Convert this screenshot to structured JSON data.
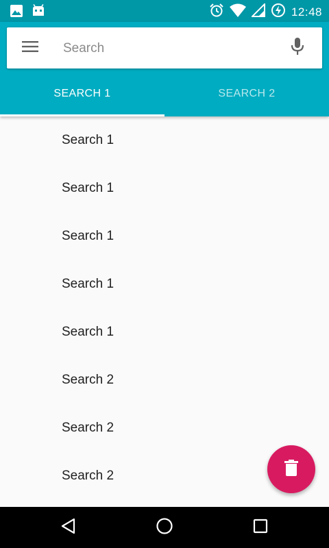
{
  "status_bar": {
    "time": "12:48",
    "left_icons": [
      "image-icon",
      "android-debug-icon"
    ],
    "right_icons": [
      "alarm-icon",
      "wifi-icon",
      "signal-icon",
      "battery-charging-icon"
    ]
  },
  "search": {
    "placeholder": "Search",
    "value": ""
  },
  "tabs": [
    {
      "label": "SEARCH 1",
      "active": true
    },
    {
      "label": "SEARCH 2",
      "active": false
    }
  ],
  "list": {
    "items": [
      "Search 1",
      "Search 1",
      "Search 1",
      "Search 1",
      "Search 1",
      "Search 2",
      "Search 2",
      "Search 2"
    ]
  },
  "fab": {
    "icon": "delete-icon"
  },
  "colors": {
    "status_bar": "#0097a7",
    "app_bar": "#00acc1",
    "fab": "#d81b60",
    "background": "#fafafa"
  },
  "nav": {
    "icons": [
      "back-icon",
      "home-icon",
      "recents-icon"
    ]
  }
}
